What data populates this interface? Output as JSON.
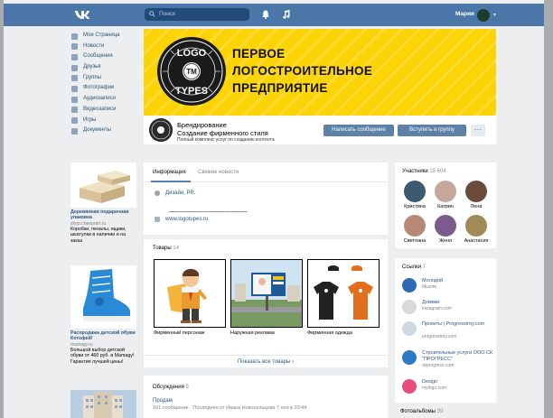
{
  "header": {
    "search_placeholder": "Поиск",
    "user_name": "Мария"
  },
  "nav": {
    "items": [
      {
        "label": "Моя Страница",
        "icon": "home-icon"
      },
      {
        "label": "Новости",
        "icon": "news-icon"
      },
      {
        "label": "Сообщения",
        "icon": "messages-icon"
      },
      {
        "label": "Друзья",
        "icon": "friends-icon"
      },
      {
        "label": "Группы",
        "icon": "groups-icon"
      },
      {
        "label": "Фотографии",
        "icon": "photos-icon"
      },
      {
        "label": "Аудиозаписи",
        "icon": "audio-icon"
      },
      {
        "label": "Видеозаписи",
        "icon": "video-icon"
      },
      {
        "label": "Игры",
        "icon": "games-icon"
      },
      {
        "label": "Документы",
        "icon": "documents-icon"
      }
    ]
  },
  "ads": [
    {
      "title": "Деревянная подарочная упаковка",
      "site": "shop.cheeprart.ru",
      "text": "Коробки, пеналы, ящики, шкатулки в наличии и на заказ"
    },
    {
      "title": "Распродажа детской обуви Котофей!",
      "site": "mamagy.ru",
      "text": "Большой выбор детской обуви от 460 руб. в Mamagy! Гарантия лучшей цены!"
    }
  ],
  "cover": {
    "title_line1": "ПЕРВОЕ",
    "title_line2": "ЛОГОСТРОИТЕЛЬНОЕ",
    "title_line3": "ПРЕДПРИЯТИЕ",
    "logo_text_top": "LOGO",
    "logo_text_bottom": "TYPES",
    "logo_tm": "TM"
  },
  "profile": {
    "name": "Брендирование",
    "status": "Создание фирменного стиля",
    "description": "Полный комплекс услуг по созданию контента",
    "message_button": "Написать сообщение",
    "join_button": "Вступить в группу",
    "more_button": "···"
  },
  "info": {
    "tab_info": "Информация",
    "tab_news": "Свежие новости",
    "category": "Дизайн, PR.",
    "separator": "——————————————",
    "website": "www.logotupes.ru"
  },
  "goods": {
    "title": "Товары",
    "count": "14",
    "items": [
      {
        "caption": "Фирменный персонаж"
      },
      {
        "caption": "Наружная реклама"
      },
      {
        "caption": "Фирменная одежда"
      }
    ],
    "show_all": "Показать все товары ›"
  },
  "discussions": {
    "title": "Обсуждения",
    "count": "5",
    "topic": "Продам",
    "meta": "161 сообщение · Последнее от Ивана Новосельцева 7 ноя в 20:44"
  },
  "members": {
    "title": "Участники",
    "count": "15 604",
    "people": [
      {
        "name": "Кристина",
        "color": "#3d5b6e"
      },
      {
        "name": "Катрин",
        "color": "#c7a79b"
      },
      {
        "name": "Лена",
        "color": "#6b4a3c"
      },
      {
        "name": "Светлана",
        "color": "#b88a75"
      },
      {
        "name": "Женя",
        "color": "#7b5a8e"
      },
      {
        "name": "Анастасия",
        "color": "#a08a58"
      }
    ]
  },
  "links": {
    "title": "Ссылки",
    "count": "7",
    "items": [
      {
        "title": "Молодой",
        "sub": "Мысли",
        "color": "#2b6bb5"
      },
      {
        "title": "Домики",
        "sub": "instagram.com",
        "color": "#d9d9d9"
      },
      {
        "title": "Проекты | Progresstroy.com",
        "sub": "progresstroy.com",
        "color": "#cfd8e0"
      },
      {
        "title": "Строительные услуги ООО СК \"ПРОГРЕСС\"",
        "sub": "skprogress.com",
        "color": "#2d77c8"
      },
      {
        "title": "Design",
        "sub": "mylogo.com",
        "color": "#e94b7a"
      }
    ]
  },
  "photos": {
    "title": "Фотоальбомы",
    "count": "39"
  }
}
